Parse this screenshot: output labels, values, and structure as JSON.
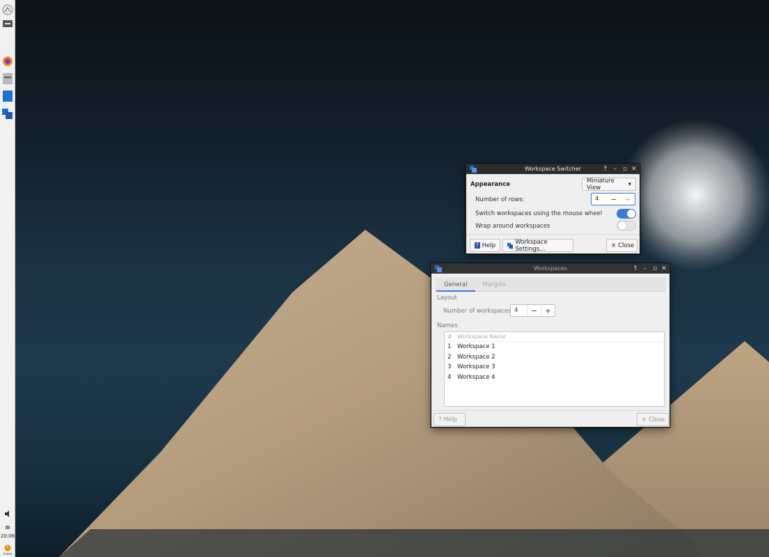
{
  "panel": {
    "clock": "20:06",
    "user_label": "trans"
  },
  "switcher": {
    "title": "Workspace Switcher",
    "appearance_label": "Appearance",
    "view_dropdown": "Miniature View",
    "rows_label": "Number of rows:",
    "rows_value": "4",
    "mouse_wheel_label": "Switch workspaces using the mouse wheel",
    "mouse_wheel_on": true,
    "wrap_label": "Wrap around workspaces",
    "wrap_on": false,
    "help_button": "Help",
    "settings_button": "Workspace Settings...",
    "close_button": "Close"
  },
  "workspaces": {
    "title": "Workspaces",
    "tabs": [
      "General",
      "Margins"
    ],
    "layout_label": "Layout",
    "count_label": "Number of workspaces:",
    "count_value": "4",
    "names_label": "Names",
    "columns": [
      "#",
      "Workspace Name"
    ],
    "rows": [
      {
        "num": "1",
        "name": "Workspace 1"
      },
      {
        "num": "2",
        "name": "Workspace 2"
      },
      {
        "num": "3",
        "name": "Workspace 3"
      },
      {
        "num": "4",
        "name": "Workspace 4"
      }
    ],
    "help_button": "Help",
    "close_button": "Close"
  },
  "colors": {
    "accent": "#3a7bd5",
    "titlebar": "#2c2c2c",
    "moon": "#f2d220",
    "sand": "#b29a7a"
  }
}
